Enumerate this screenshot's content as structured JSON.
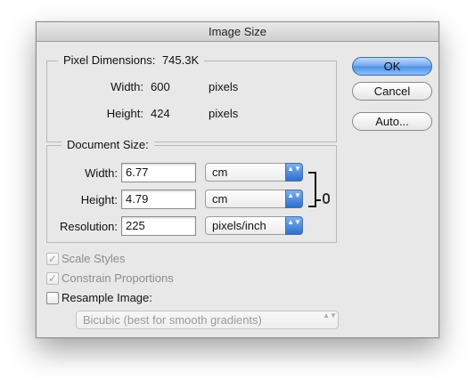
{
  "window": {
    "title": "Image Size"
  },
  "pixel_dimensions": {
    "legend": "Pixel Dimensions:",
    "size": "745.3K",
    "width_label": "Width:",
    "width_value": "600",
    "width_unit": "pixels",
    "height_label": "Height:",
    "height_value": "424",
    "height_unit": "pixels"
  },
  "document_size": {
    "legend": "Document Size:",
    "width_label": "Width:",
    "width_value": "6.77",
    "width_unit": "cm",
    "height_label": "Height:",
    "height_value": "4.79",
    "height_unit": "cm",
    "resolution_label": "Resolution:",
    "resolution_value": "225",
    "resolution_unit": "pixels/inch"
  },
  "options": {
    "scale_styles": {
      "label": "Scale Styles",
      "checked": true,
      "enabled": false
    },
    "constrain_proportions": {
      "label": "Constrain Proportions",
      "checked": true,
      "enabled": false
    },
    "resample_image": {
      "label": "Resample Image:",
      "checked": false,
      "enabled": true
    },
    "resample_method": "Bicubic (best for smooth gradients)"
  },
  "buttons": {
    "ok": "OK",
    "cancel": "Cancel",
    "auto": "Auto..."
  },
  "icons": {
    "checkmark": "✓",
    "select_arrows": "▲▼"
  },
  "colors": {
    "accent": "#4d8fe6",
    "dialog_bg": "#e8e8e8"
  }
}
